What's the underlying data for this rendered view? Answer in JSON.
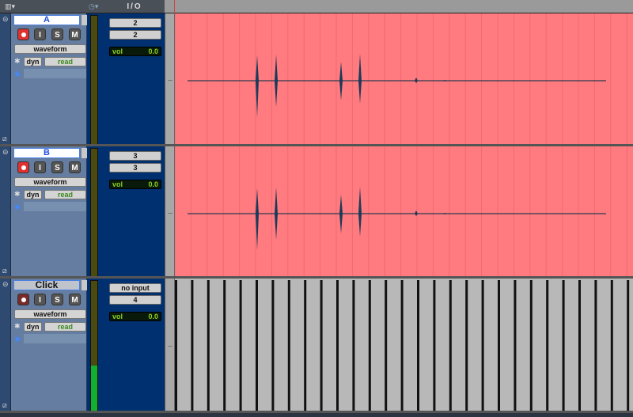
{
  "header": {
    "io_label": "I/O"
  },
  "tracks": [
    {
      "name": "A",
      "view": "waveform",
      "dyn": "dyn",
      "automation": "read",
      "input": "2",
      "output": "2",
      "vol_label": "vol",
      "vol": "0.0",
      "record_armed": true,
      "meter_level": 0,
      "color": "#ff7b7f"
    },
    {
      "name": "B",
      "view": "waveform",
      "dyn": "dyn",
      "automation": "read",
      "input": "3",
      "output": "3",
      "vol_label": "vol",
      "vol": "0.0",
      "record_armed": true,
      "meter_level": 0,
      "color": "#ff7b7f"
    },
    {
      "name": "Click",
      "view": "waveform",
      "dyn": "dyn",
      "automation": "read",
      "input": "no input",
      "output": "4",
      "vol_label": "vol",
      "vol": "0.0",
      "record_armed": false,
      "meter_level": 0.35,
      "color": "#b8b8b8"
    }
  ],
  "buttons": {
    "input": "I",
    "solo": "S",
    "mute": "M"
  }
}
